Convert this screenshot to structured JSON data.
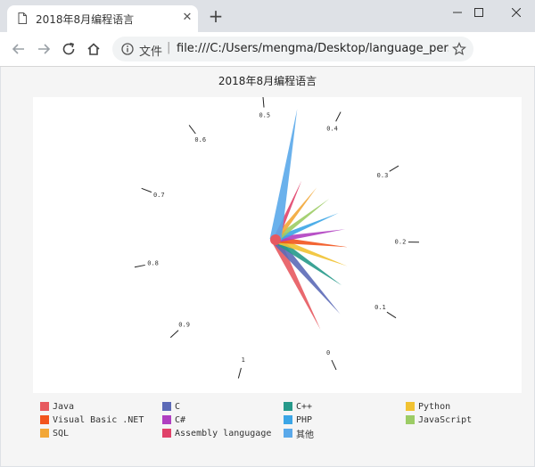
{
  "browser": {
    "tab_title": "2018年8月编程语言",
    "tab_close": "✕",
    "new_tab": "+",
    "site_label": "文件",
    "url": "file:///C:/Users/mengma/Desktop/language_per..."
  },
  "chart_data": {
    "type": "polar",
    "title": "2018年8月编程语言",
    "ticks": [
      "0",
      "0.1",
      "0.2",
      "0.3",
      "0.4",
      "0.5",
      "0.6",
      "0.7",
      "0.8",
      "0.9",
      "1"
    ],
    "series": [
      {
        "name": "Java",
        "color": "#e7595f",
        "value": 0.19
      },
      {
        "name": "C",
        "color": "#5c6ab7",
        "value": 0.18
      },
      {
        "name": "C++",
        "color": "#26998a",
        "value": 0.09
      },
      {
        "name": "Python",
        "color": "#f1c232",
        "value": 0.07
      },
      {
        "name": "Visual Basic .NET",
        "color": "#f2541d",
        "value": 0.05
      },
      {
        "name": "C#",
        "color": "#b03fc1",
        "value": 0.04
      },
      {
        "name": "PHP",
        "color": "#3ba5e6",
        "value": 0.03
      },
      {
        "name": "JavaScript",
        "color": "#9ccc65",
        "value": 0.025
      },
      {
        "name": "SQL",
        "color": "#f2a737",
        "value": 0.02
      },
      {
        "name": "Assembly langugage",
        "color": "#e0426a",
        "value": 0.01
      },
      {
        "name": "其他",
        "color": "#5aa9ea",
        "value": 0.35
      }
    ],
    "legend_position": "bottom"
  }
}
